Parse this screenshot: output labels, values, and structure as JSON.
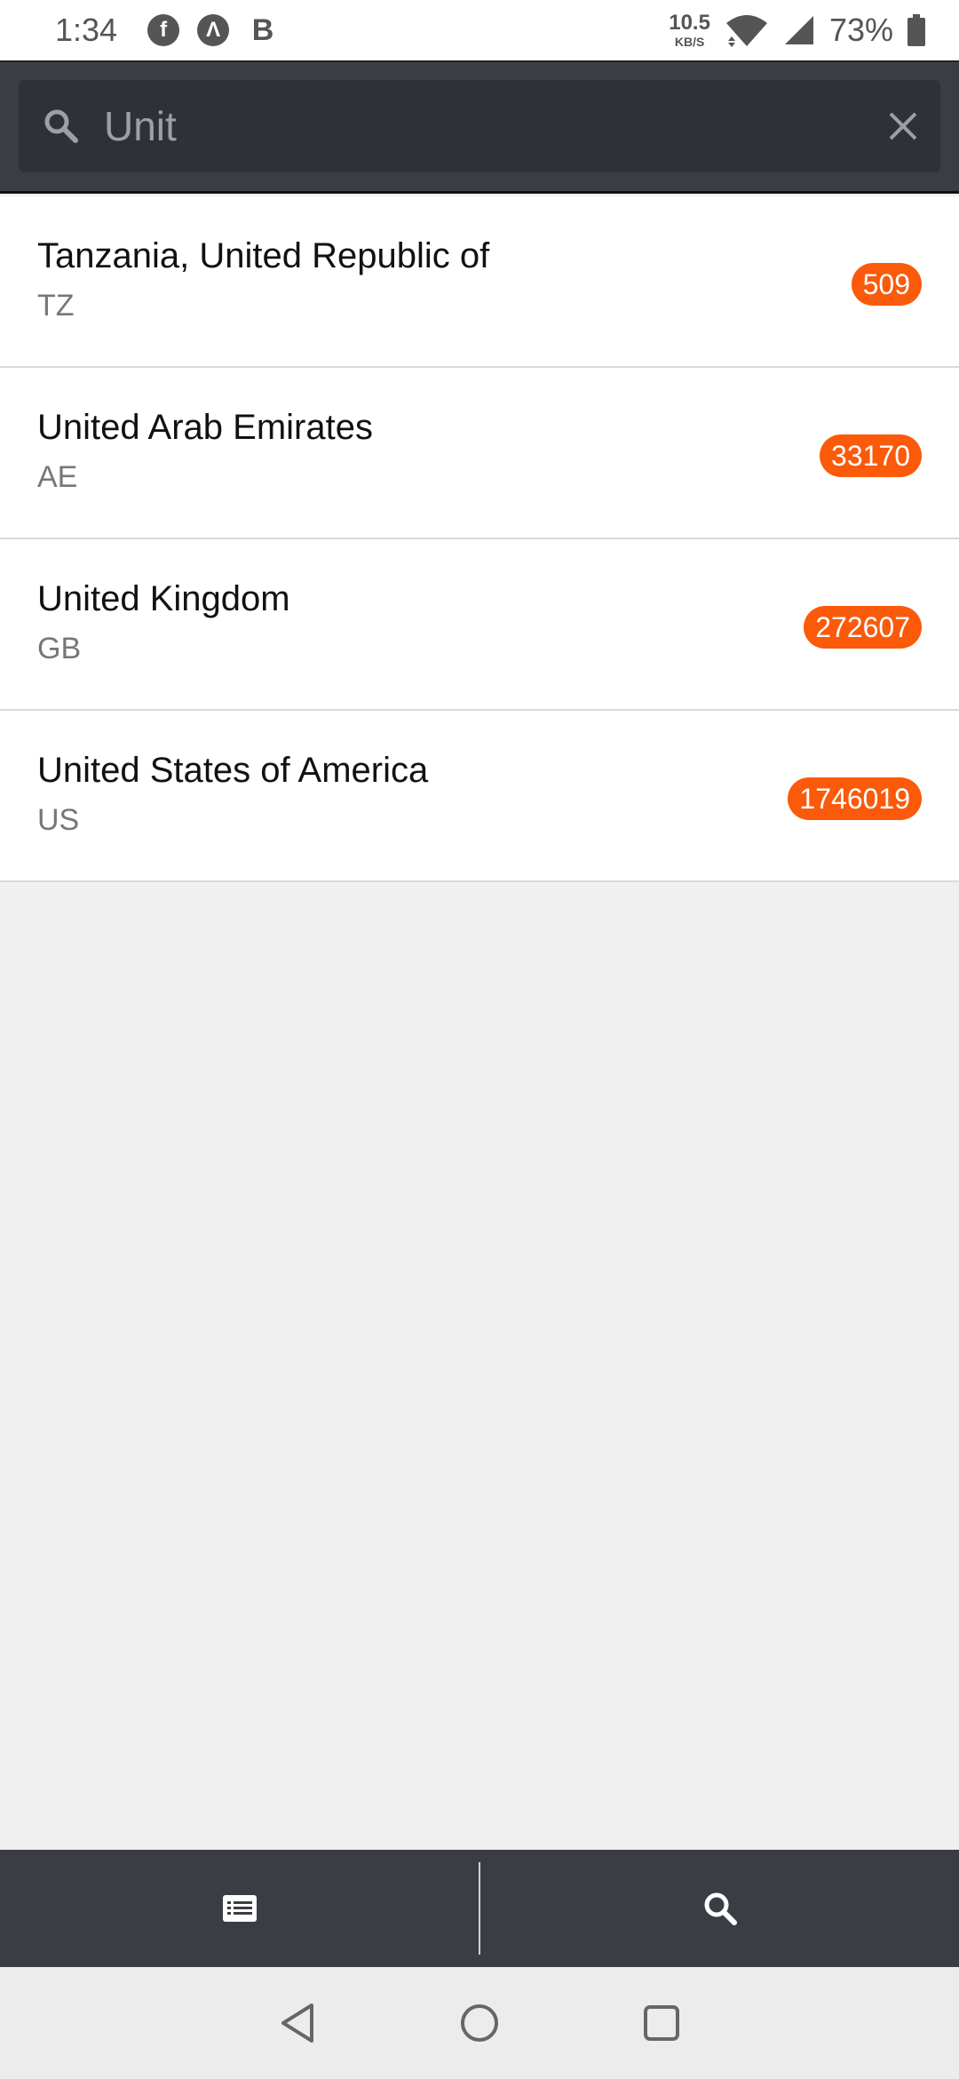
{
  "status_bar": {
    "time": "1:34",
    "app_icons": [
      "f",
      "Λ",
      "B"
    ],
    "net_speed_value": "10.5",
    "net_speed_unit": "KB/S",
    "battery_percent": "73%"
  },
  "search": {
    "query": "Unit"
  },
  "results": [
    {
      "name": "Tanzania, United Republic of",
      "code": "TZ",
      "count": "509"
    },
    {
      "name": "United Arab Emirates",
      "code": "AE",
      "count": "33170"
    },
    {
      "name": "United Kingdom",
      "code": "GB",
      "count": "272607"
    },
    {
      "name": "United States of America",
      "code": "US",
      "count": "1746019"
    }
  ],
  "tabs": [
    {
      "icon": "list-icon"
    },
    {
      "icon": "search-icon"
    }
  ],
  "colors": {
    "badge": "#fa5a0a",
    "header": "#3a3e44",
    "search_box": "#2e3237"
  }
}
